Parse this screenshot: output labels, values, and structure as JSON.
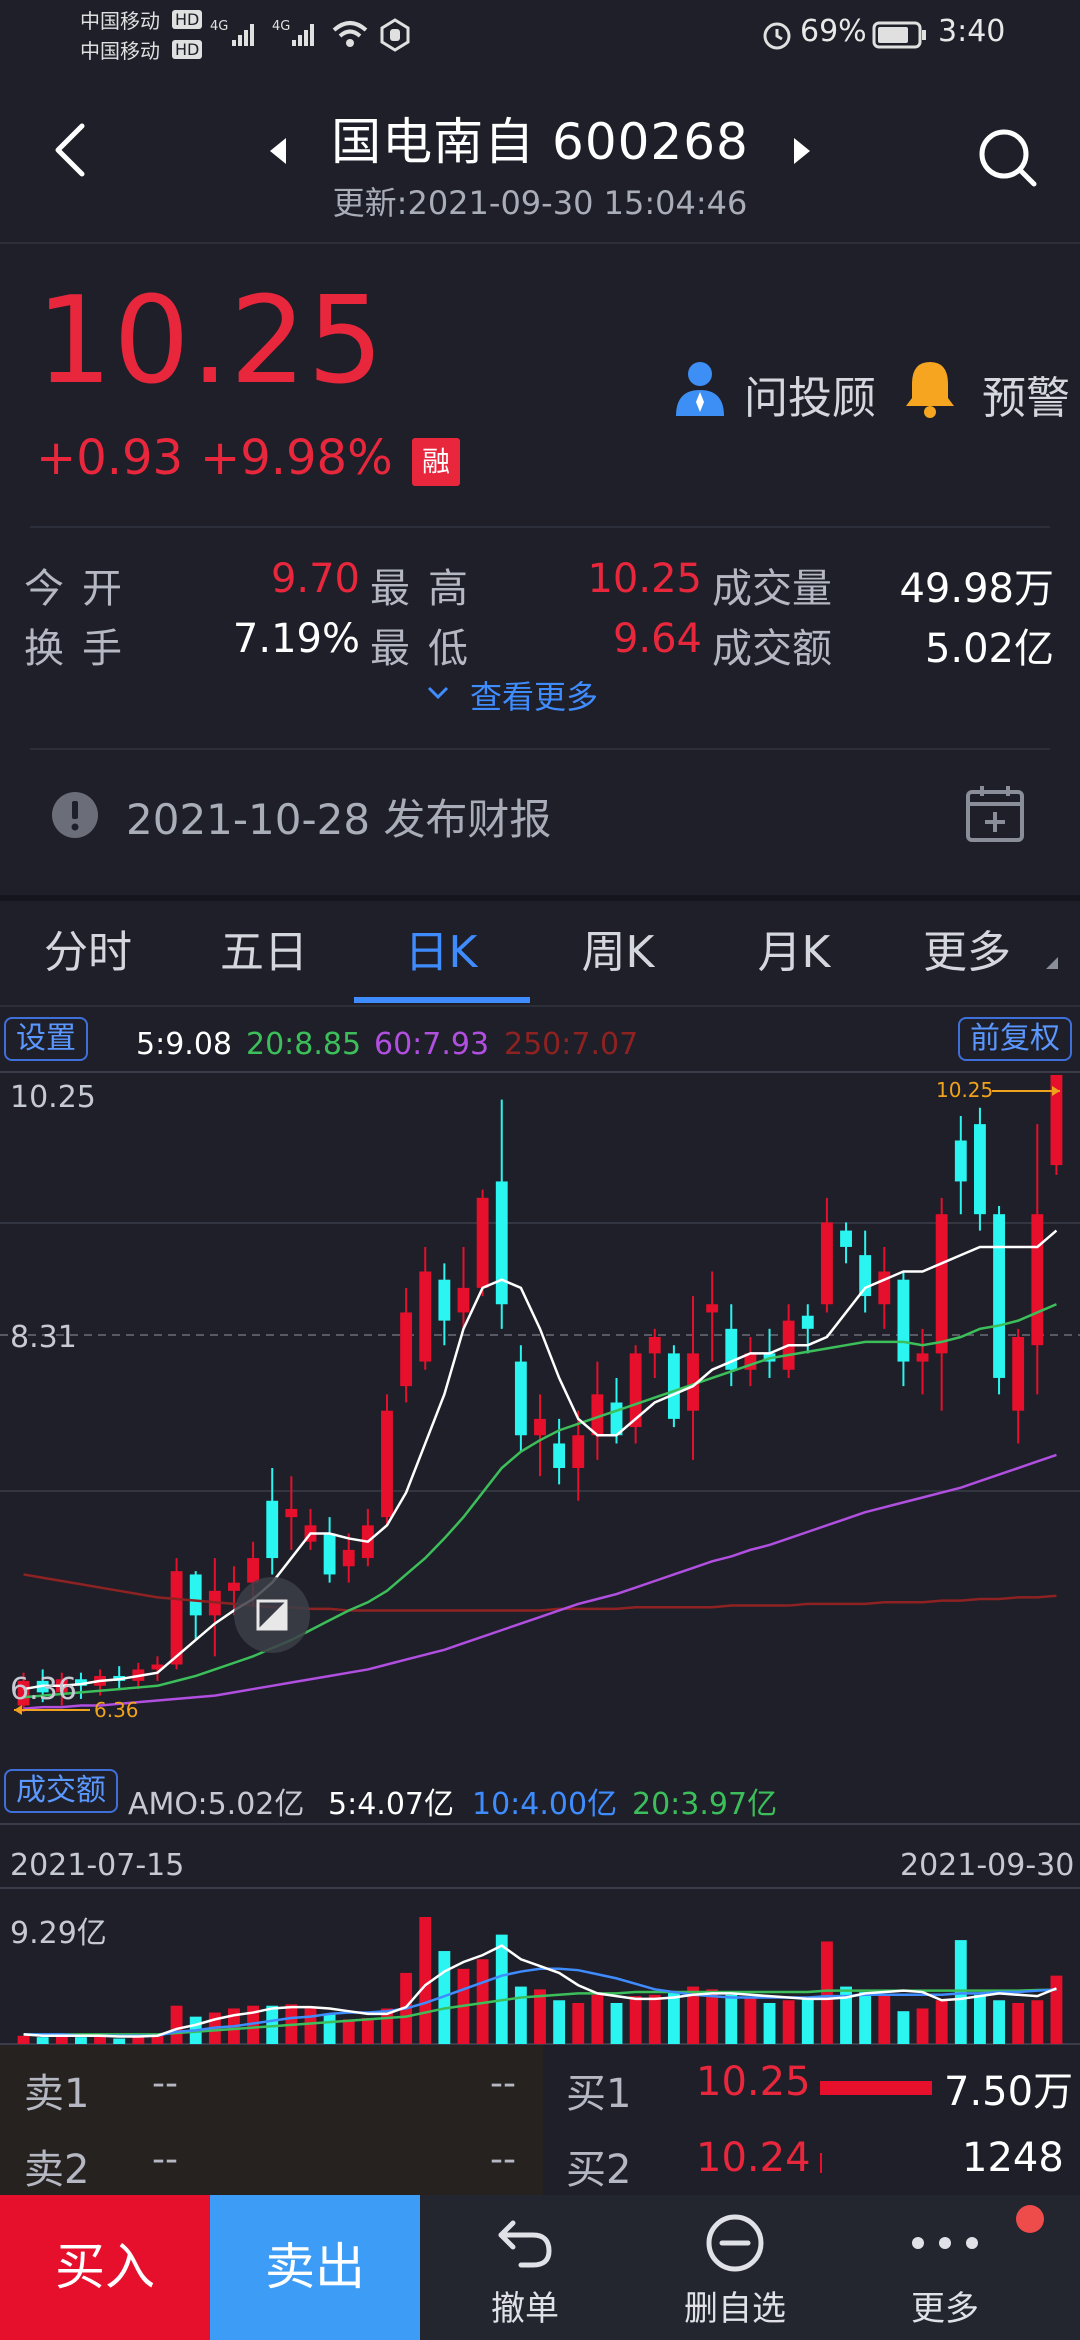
{
  "status_bar": {
    "carrier1": "中国移动",
    "carrier2": "中国移动",
    "hd": "HD",
    "net": "4G",
    "battery": "69%",
    "time": "3:40"
  },
  "header": {
    "title": "国电南自 600268",
    "updated": "更新:2021-09-30 15:04:46"
  },
  "quote": {
    "price": "10.25",
    "change": "+0.93",
    "change_pct": "+9.98%",
    "margin_badge": "融",
    "advisor_label": "问投顾",
    "alert_label": "预警",
    "stats": {
      "open_label": "今开",
      "open": "9.70",
      "high_label": "最高",
      "high": "10.25",
      "volume_label": "成交量",
      "volume": "49.98万",
      "turnover_label": "换手",
      "turnover": "7.19%",
      "low_label": "最低",
      "low": "9.64",
      "amount_label": "成交额",
      "amount": "5.02亿"
    },
    "more_label": "查看更多",
    "report": "2021-10-28 发布财报"
  },
  "tabs": [
    "分时",
    "五日",
    "日K",
    "周K",
    "月K",
    "更多"
  ],
  "active_tab": "日K",
  "kline": {
    "settings_label": "设置",
    "adjust_label": "前复权",
    "ma": [
      {
        "label": "5:9.08",
        "color": "#ffffff"
      },
      {
        "label": "20:8.85",
        "color": "#3cbf5a"
      },
      {
        "label": "60:7.93",
        "color": "#b04fe0"
      },
      {
        "label": "250:7.07",
        "color": "#9e2a2a"
      }
    ],
    "y_top": "10.25",
    "y_mid": "8.31",
    "y_low": "6.36",
    "high_marker": "10.25",
    "low_marker": "6.36",
    "x_start": "2021-07-15",
    "x_end": "2021-09-30"
  },
  "amount_panel": {
    "label": "成交额",
    "amo": "AMO:5.02亿",
    "ma5": "5:4.07亿",
    "ma10": "10:4.00亿",
    "ma20": "20:3.97亿",
    "y_top": "9.29亿"
  },
  "order_book": {
    "sell1_label": "卖1",
    "sell1_price": "--",
    "sell1_vol": "--",
    "sell2_label": "卖2",
    "sell2_price": "--",
    "sell2_vol": "--",
    "buy1_label": "买1",
    "buy1_price": "10.25",
    "buy1_vol": "7.50万",
    "buy2_label": "买2",
    "buy2_price": "10.24",
    "buy2_vol": "1248"
  },
  "bottom_bar": {
    "buy": "买入",
    "sell": "卖出",
    "cancel": "撤单",
    "remove_fav": "删自选",
    "more": "更多"
  },
  "chart_data": {
    "type": "candlestick",
    "price_range": [
      6.36,
      10.25
    ],
    "candles": [
      {
        "o": 6.4,
        "h": 6.6,
        "l": 6.36,
        "c": 6.55,
        "up": true
      },
      {
        "o": 6.55,
        "h": 6.62,
        "l": 6.42,
        "c": 6.48,
        "up": false
      },
      {
        "o": 6.48,
        "h": 6.6,
        "l": 6.4,
        "c": 6.56,
        "up": true
      },
      {
        "o": 6.56,
        "h": 6.6,
        "l": 6.44,
        "c": 6.52,
        "up": false
      },
      {
        "o": 6.52,
        "h": 6.62,
        "l": 6.46,
        "c": 6.58,
        "up": true
      },
      {
        "o": 6.58,
        "h": 6.64,
        "l": 6.5,
        "c": 6.55,
        "up": false
      },
      {
        "o": 6.55,
        "h": 6.66,
        "l": 6.5,
        "c": 6.62,
        "up": true
      },
      {
        "o": 6.62,
        "h": 6.7,
        "l": 6.55,
        "c": 6.65,
        "up": true
      },
      {
        "o": 6.65,
        "h": 7.3,
        "l": 6.62,
        "c": 7.22,
        "up": true
      },
      {
        "o": 7.2,
        "h": 7.22,
        "l": 6.8,
        "c": 6.95,
        "up": false
      },
      {
        "o": 6.95,
        "h": 7.3,
        "l": 6.7,
        "c": 7.1,
        "up": true
      },
      {
        "o": 7.1,
        "h": 7.25,
        "l": 6.95,
        "c": 7.15,
        "up": true
      },
      {
        "o": 7.15,
        "h": 7.4,
        "l": 7.0,
        "c": 7.3,
        "up": true
      },
      {
        "o": 7.3,
        "h": 7.85,
        "l": 7.2,
        "c": 7.65,
        "up": false
      },
      {
        "o": 7.55,
        "h": 7.8,
        "l": 7.35,
        "c": 7.6,
        "up": true
      },
      {
        "o": 7.5,
        "h": 7.6,
        "l": 7.35,
        "c": 7.4,
        "up": true
      },
      {
        "o": 7.45,
        "h": 7.55,
        "l": 7.15,
        "c": 7.2,
        "up": false
      },
      {
        "o": 7.25,
        "h": 7.45,
        "l": 7.15,
        "c": 7.35,
        "up": true
      },
      {
        "o": 7.3,
        "h": 7.6,
        "l": 7.25,
        "c": 7.5,
        "up": true
      },
      {
        "o": 7.55,
        "h": 8.3,
        "l": 7.5,
        "c": 8.2,
        "up": true
      },
      {
        "o": 8.35,
        "h": 8.95,
        "l": 8.25,
        "c": 8.8,
        "up": true
      },
      {
        "o": 8.5,
        "h": 9.2,
        "l": 8.45,
        "c": 9.05,
        "up": true
      },
      {
        "o": 9.0,
        "h": 9.1,
        "l": 8.6,
        "c": 8.75,
        "up": false
      },
      {
        "o": 8.8,
        "h": 9.2,
        "l": 8.7,
        "c": 8.95,
        "up": true
      },
      {
        "o": 8.95,
        "h": 9.55,
        "l": 8.9,
        "c": 9.5,
        "up": true
      },
      {
        "o": 9.6,
        "h": 10.1,
        "l": 8.7,
        "c": 8.85,
        "up": false
      },
      {
        "o": 8.5,
        "h": 8.6,
        "l": 7.95,
        "c": 8.05,
        "up": false
      },
      {
        "o": 8.05,
        "h": 8.3,
        "l": 7.8,
        "c": 8.15,
        "up": true
      },
      {
        "o": 8.0,
        "h": 8.15,
        "l": 7.75,
        "c": 7.85,
        "up": false
      },
      {
        "o": 7.85,
        "h": 8.2,
        "l": 7.65,
        "c": 8.05,
        "up": true
      },
      {
        "o": 8.05,
        "h": 8.5,
        "l": 7.9,
        "c": 8.3,
        "up": true
      },
      {
        "o": 8.25,
        "h": 8.4,
        "l": 8.0,
        "c": 8.05,
        "up": false
      },
      {
        "o": 8.1,
        "h": 8.6,
        "l": 8.0,
        "c": 8.55,
        "up": true
      },
      {
        "o": 8.55,
        "h": 8.7,
        "l": 8.4,
        "c": 8.65,
        "up": true
      },
      {
        "o": 8.55,
        "h": 8.6,
        "l": 8.1,
        "c": 8.15,
        "up": false
      },
      {
        "o": 8.2,
        "h": 8.9,
        "l": 7.9,
        "c": 8.55,
        "up": true
      },
      {
        "o": 8.8,
        "h": 9.05,
        "l": 8.5,
        "c": 8.85,
        "up": true
      },
      {
        "o": 8.7,
        "h": 8.85,
        "l": 8.35,
        "c": 8.45,
        "up": false
      },
      {
        "o": 8.45,
        "h": 8.65,
        "l": 8.35,
        "c": 8.55,
        "up": true
      },
      {
        "o": 8.55,
        "h": 8.7,
        "l": 8.4,
        "c": 8.5,
        "up": false
      },
      {
        "o": 8.45,
        "h": 8.85,
        "l": 8.4,
        "c": 8.75,
        "up": true
      },
      {
        "o": 8.7,
        "h": 8.85,
        "l": 8.55,
        "c": 8.78,
        "up": false
      },
      {
        "o": 8.85,
        "h": 9.5,
        "l": 8.8,
        "c": 9.35,
        "up": true
      },
      {
        "o": 9.3,
        "h": 9.35,
        "l": 9.1,
        "c": 9.2,
        "up": false
      },
      {
        "o": 9.15,
        "h": 9.3,
        "l": 8.8,
        "c": 8.9,
        "up": false
      },
      {
        "o": 8.85,
        "h": 9.2,
        "l": 8.7,
        "c": 9.05,
        "up": true
      },
      {
        "o": 9.0,
        "h": 9.05,
        "l": 8.35,
        "c": 8.5,
        "up": false
      },
      {
        "o": 8.5,
        "h": 8.7,
        "l": 8.3,
        "c": 8.55,
        "up": true
      },
      {
        "o": 8.55,
        "h": 9.5,
        "l": 8.2,
        "c": 9.4,
        "up": true
      },
      {
        "o": 9.6,
        "h": 10.0,
        "l": 9.4,
        "c": 9.85,
        "up": false
      },
      {
        "o": 9.95,
        "h": 10.05,
        "l": 9.3,
        "c": 9.4,
        "up": false
      },
      {
        "o": 9.4,
        "h": 9.45,
        "l": 8.3,
        "c": 8.4,
        "up": false
      },
      {
        "o": 8.2,
        "h": 8.7,
        "l": 8.0,
        "c": 8.65,
        "up": true
      },
      {
        "o": 8.6,
        "h": 9.95,
        "l": 8.3,
        "c": 9.4,
        "up": true
      },
      {
        "o": 9.7,
        "h": 10.25,
        "l": 9.64,
        "c": 10.25,
        "up": true
      }
    ],
    "ma5": [
      6.5,
      6.52,
      6.52,
      6.53,
      6.55,
      6.56,
      6.58,
      6.6,
      6.7,
      6.8,
      6.9,
      6.98,
      7.05,
      7.15,
      7.3,
      7.45,
      7.45,
      7.42,
      7.4,
      7.5,
      7.7,
      8.0,
      8.3,
      8.7,
      8.95,
      9.0,
      8.95,
      8.7,
      8.4,
      8.15,
      8.05,
      8.05,
      8.15,
      8.25,
      8.3,
      8.35,
      8.45,
      8.5,
      8.55,
      8.55,
      8.6,
      8.6,
      8.65,
      8.8,
      8.95,
      9.0,
      9.05,
      9.05,
      9.1,
      9.15,
      9.2,
      9.2,
      9.2,
      9.2,
      9.3
    ],
    "ma20": [
      6.45,
      6.46,
      6.47,
      6.48,
      6.49,
      6.5,
      6.51,
      6.52,
      6.55,
      6.58,
      6.62,
      6.66,
      6.7,
      6.75,
      6.8,
      6.86,
      6.92,
      6.98,
      7.03,
      7.1,
      7.2,
      7.3,
      7.42,
      7.55,
      7.7,
      7.85,
      7.95,
      8.02,
      8.08,
      8.12,
      8.16,
      8.2,
      8.24,
      8.28,
      8.32,
      8.36,
      8.4,
      8.44,
      8.48,
      8.52,
      8.54,
      8.56,
      8.58,
      8.6,
      8.62,
      8.62,
      8.62,
      8.6,
      8.62,
      8.65,
      8.7,
      8.72,
      8.75,
      8.8,
      8.85
    ],
    "ma60": [
      6.38,
      6.39,
      6.39,
      6.4,
      6.4,
      6.41,
      6.42,
      6.43,
      6.44,
      6.45,
      6.46,
      6.48,
      6.5,
      6.52,
      6.54,
      6.56,
      6.58,
      6.6,
      6.62,
      6.65,
      6.68,
      6.71,
      6.74,
      6.78,
      6.82,
      6.86,
      6.9,
      6.94,
      6.98,
      7.02,
      7.05,
      7.08,
      7.12,
      7.16,
      7.2,
      7.24,
      7.28,
      7.31,
      7.35,
      7.38,
      7.42,
      7.46,
      7.5,
      7.54,
      7.58,
      7.61,
      7.64,
      7.67,
      7.7,
      7.73,
      7.77,
      7.81,
      7.85,
      7.89,
      7.93
    ],
    "ma250": [
      7.2,
      7.18,
      7.16,
      7.14,
      7.12,
      7.1,
      7.08,
      7.06,
      7.05,
      7.04,
      7.03,
      7.02,
      7.01,
      7.0,
      7.0,
      6.99,
      6.99,
      6.98,
      6.98,
      6.98,
      6.98,
      6.98,
      6.98,
      6.98,
      6.98,
      6.98,
      6.98,
      6.98,
      6.99,
      6.99,
      6.99,
      6.99,
      7.0,
      7.0,
      7.0,
      7.0,
      7.0,
      7.01,
      7.01,
      7.01,
      7.01,
      7.02,
      7.02,
      7.02,
      7.02,
      7.03,
      7.03,
      7.03,
      7.04,
      7.04,
      7.05,
      7.05,
      7.06,
      7.06,
      7.07
    ],
    "amount_range": [
      0,
      9.29
    ],
    "amounts": [
      0.6,
      0.5,
      0.6,
      0.5,
      0.6,
      0.4,
      0.5,
      0.7,
      2.8,
      2.0,
      2.3,
      2.6,
      2.8,
      2.8,
      2.9,
      2.6,
      2.2,
      1.8,
      1.9,
      2.6,
      5.2,
      9.29,
      6.8,
      5.5,
      6.2,
      8.0,
      4.2,
      4.0,
      3.2,
      3.0,
      3.6,
      3.0,
      3.5,
      3.6,
      3.8,
      4.2,
      4.0,
      3.6,
      3.4,
      3.0,
      3.2,
      3.3,
      7.5,
      4.2,
      3.8,
      3.6,
      2.4,
      2.6,
      3.2,
      7.6,
      3.6,
      3.2,
      3.0,
      3.2,
      5.0
    ],
    "amo_ma5": [
      0.7,
      0.6,
      0.6,
      0.6,
      0.6,
      0.55,
      0.55,
      0.6,
      1.1,
      1.4,
      1.8,
      2.1,
      2.3,
      2.6,
      2.7,
      2.7,
      2.6,
      2.4,
      2.2,
      2.2,
      2.7,
      4.3,
      5.3,
      6.0,
      6.5,
      7.2,
      6.2,
      5.7,
      5.2,
      4.3,
      3.7,
      3.5,
      3.3,
      3.3,
      3.4,
      3.6,
      3.7,
      3.7,
      3.6,
      3.5,
      3.4,
      3.3,
      3.3,
      3.4,
      3.7,
      3.8,
      3.9,
      3.8,
      3.2,
      3.3,
      3.5,
      3.7,
      3.6,
      3.5,
      4.07
    ],
    "amo_ma10": [
      0.7,
      0.7,
      0.7,
      0.6,
      0.6,
      0.6,
      0.6,
      0.6,
      0.9,
      1.0,
      1.2,
      1.3,
      1.5,
      1.7,
      1.9,
      2.0,
      2.2,
      2.3,
      2.3,
      2.4,
      2.6,
      3.0,
      3.5,
      4.0,
      4.5,
      5.0,
      5.3,
      5.5,
      5.5,
      5.4,
      5.1,
      4.8,
      4.4,
      4.0,
      3.8,
      3.6,
      3.5,
      3.4,
      3.4,
      3.4,
      3.4,
      3.4,
      3.5,
      3.5,
      3.6,
      3.6,
      3.6,
      3.6,
      3.6,
      3.7,
      3.7,
      3.8,
      3.8,
      3.9,
      4.0
    ],
    "amo_ma20": [
      0.7,
      0.7,
      0.7,
      0.7,
      0.7,
      0.7,
      0.7,
      0.7,
      0.8,
      0.9,
      1.0,
      1.1,
      1.2,
      1.3,
      1.4,
      1.5,
      1.6,
      1.7,
      1.8,
      1.9,
      2.0,
      2.3,
      2.6,
      2.8,
      3.0,
      3.2,
      3.4,
      3.5,
      3.6,
      3.7,
      3.7,
      3.7,
      3.8,
      3.8,
      3.8,
      3.8,
      3.8,
      3.8,
      3.8,
      3.8,
      3.8,
      3.8,
      3.9,
      3.9,
      3.9,
      3.9,
      3.9,
      3.9,
      3.9,
      3.9,
      3.9,
      3.9,
      3.9,
      3.95,
      3.97
    ]
  }
}
